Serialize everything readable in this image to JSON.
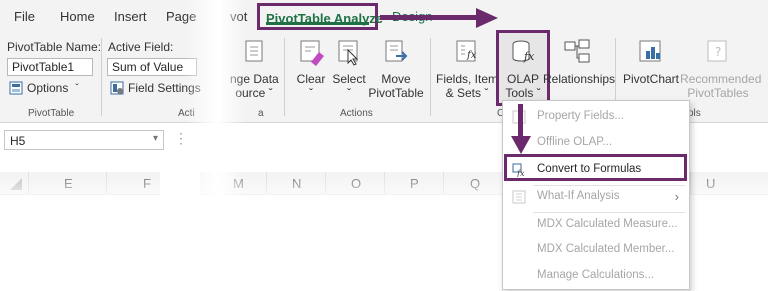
{
  "tabs": {
    "file": "File",
    "home": "Home",
    "insert": "Insert",
    "page": "Page",
    "pivot": "vot",
    "pivottable_analyze": "PivotTable Analyze",
    "design": "Design"
  },
  "pivottable_group": {
    "name_label": "PivotTable Name:",
    "name_value": "PivotTable1",
    "options_label": "Options",
    "group_label": "PivotTable"
  },
  "active_field_group": {
    "label": "Active Field:",
    "value": "Sum of Value",
    "field_settings": "Field Settings",
    "group_label": "Acti"
  },
  "data_group": {
    "change_data_line1": "nge Data",
    "change_data_line2": "ource ˇ",
    "group_label": "a"
  },
  "actions_group": {
    "clear": "Clear",
    "clear_caret": "ˇ",
    "select": "Select",
    "select_caret": "ˇ",
    "move_line1": "Move",
    "move_line2": "PivotTable",
    "group_label": "Actions"
  },
  "calculations_group": {
    "fields_line1": "Fields, Items",
    "fields_line2": "& Sets ˇ",
    "olap_line1": "OLAP",
    "olap_line2": "Tools ˇ",
    "relationships": "Relationships",
    "group_label": "C"
  },
  "tools_group": {
    "pivotchart": "PivotChart",
    "recommended_line1": "Recommended",
    "recommended_line2": "PivotTables",
    "group_label": "ols"
  },
  "formula_bar": {
    "cell_ref": "H5"
  },
  "columns": [
    "E",
    "F",
    "M",
    "N",
    "O",
    "P",
    "Q",
    "U"
  ],
  "menu": {
    "items": [
      {
        "label": "Property Fields...",
        "enabled": false
      },
      {
        "label": "Offline OLAP...",
        "enabled": false
      },
      {
        "label": "Convert to Formulas",
        "enabled": true
      },
      {
        "label": "What-If Analysis",
        "enabled": false
      },
      {
        "label": "MDX Calculated Measure...",
        "enabled": false
      },
      {
        "label": "MDX Calculated Member...",
        "enabled": false
      },
      {
        "label": "Manage Calculations...",
        "enabled": false
      }
    ]
  },
  "colors": {
    "highlight": "#6b2a6b",
    "active_tab_text": "#1e7145",
    "ribbon_bg": "#f3f3f3",
    "disabled_text": "#a6a6a6"
  }
}
